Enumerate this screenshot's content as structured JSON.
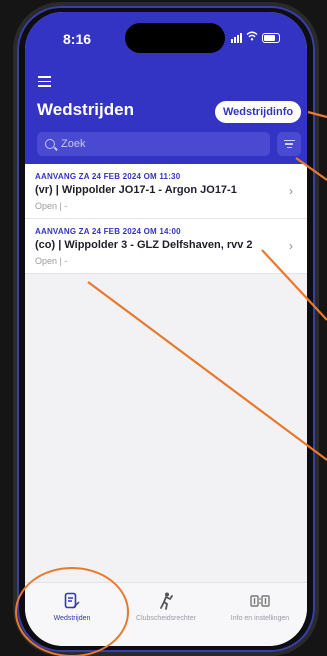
{
  "status_bar": {
    "time": "8:16"
  },
  "header": {
    "title": "Wedstrijden",
    "info_button": "Wedstrijdinfo",
    "search_placeholder": "Zoek"
  },
  "matches": [
    {
      "date": "AANVANG ZA 24 FEB 2024 OM 11:30",
      "name": "(vr) | Wippolder JO17-1 - Argon JO17-1",
      "status": "Open | -"
    },
    {
      "date": "AANVANG ZA 24 FEB 2024 OM 14:00",
      "name": "(co) | Wippolder 3 - GLZ Delfshaven, rvv 2",
      "status": "Open | -"
    }
  ],
  "tabs": [
    {
      "label": "Wedstrijden",
      "icon": "document-edit-icon",
      "active": true
    },
    {
      "label": "Clubscheidsrechter",
      "icon": "referee-icon",
      "active": false
    },
    {
      "label": "Info en instellingen",
      "icon": "scoreboard-icon",
      "active": false
    }
  ],
  "colors": {
    "primary": "#3434c4",
    "annotation": "#e8792e"
  }
}
